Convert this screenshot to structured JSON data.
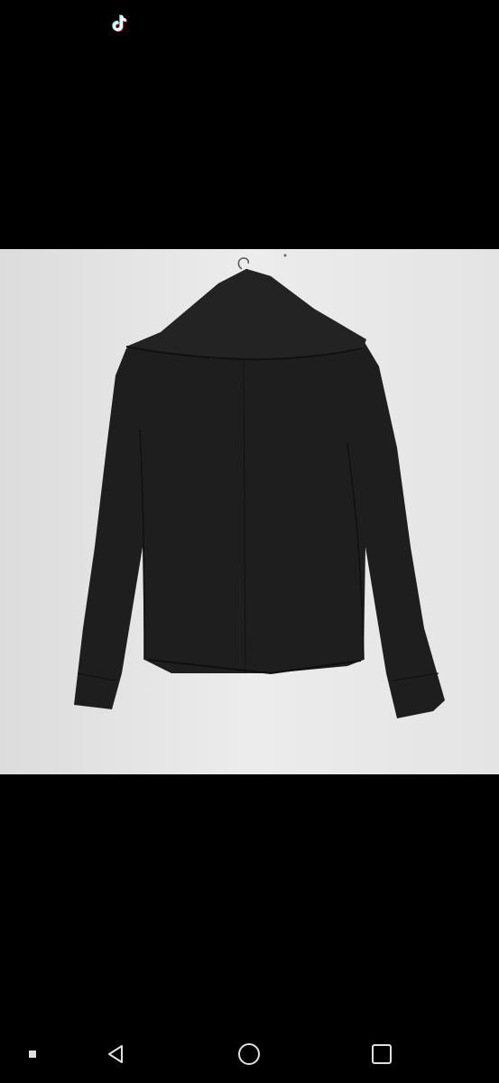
{
  "status_bar": {
    "app_icon": "tiktok-icon"
  },
  "photo": {
    "subject_icon": "black-jacket-back-view"
  },
  "nav_bar": {
    "buttons": [
      {
        "icon": "menu-dot-icon"
      },
      {
        "icon": "back-triangle-icon"
      },
      {
        "icon": "home-circle-icon"
      },
      {
        "icon": "recents-square-icon"
      }
    ]
  },
  "colors": {
    "background": "#000000",
    "wall": "#e8e8e8",
    "jacket": "#1d1d1d",
    "nav_icon": "#e0e0e0"
  }
}
